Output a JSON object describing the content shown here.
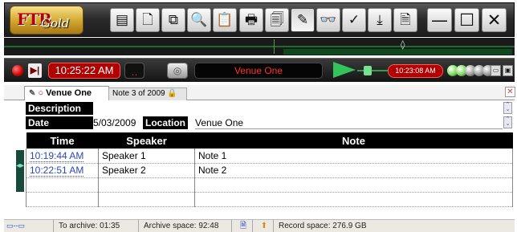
{
  "app": {
    "logo_main": "FTR",
    "logo_sub": "Gold"
  },
  "toolbar": {
    "buttons": [
      {
        "icon": "list-icon",
        "glyph": "▤"
      },
      {
        "icon": "new-page-icon",
        "glyph": "🗋"
      },
      {
        "icon": "copy-pages-icon",
        "glyph": "⧉"
      },
      {
        "icon": "find-page-icon",
        "glyph": "🔍"
      },
      {
        "icon": "paste-icon",
        "glyph": "📋"
      },
      {
        "icon": "print-icon",
        "glyph": "🖶"
      },
      {
        "icon": "print-preview-icon",
        "glyph": "🗐"
      },
      {
        "icon": "edit-note-icon",
        "glyph": "✎"
      },
      {
        "icon": "binoculars-icon",
        "glyph": "👓"
      },
      {
        "icon": "spellcheck-icon",
        "glyph": "✓"
      },
      {
        "icon": "insert-icon",
        "glyph": "⤓"
      },
      {
        "icon": "document-icon",
        "glyph": "🗎"
      }
    ],
    "window_controls": {
      "minimize": "—",
      "maximize": "☐",
      "close": "✕"
    }
  },
  "transport": {
    "current_time": "10:25:22 AM",
    "dots": "‥",
    "venue": "Venue One",
    "playback_time": "10:23:08 AM",
    "channel_colors": [
      "#7bdc5a",
      "#7bdc5a",
      "#9a9a9a",
      "#9a9a9a",
      "#9a9a9a"
    ]
  },
  "tabs": {
    "active_label": "Venue One",
    "inactive_label": "Note 3 of 2009"
  },
  "fields": {
    "description_label": "Description",
    "description_value": "",
    "date_label": "Date",
    "date_value": "5/03/2009",
    "location_label": "Location",
    "location_value": "Venue One"
  },
  "notes": {
    "columns": [
      "Time",
      "Speaker",
      "Note"
    ],
    "rows": [
      {
        "time": "10:19:44 AM",
        "speaker": "Speaker 1",
        "note": "Note 1"
      },
      {
        "time": "10:22:51 AM",
        "speaker": "Speaker 2",
        "note": "Note 2"
      },
      {
        "time": "",
        "speaker": "",
        "note": ""
      },
      {
        "time": "",
        "speaker": "",
        "note": ""
      }
    ]
  },
  "status": {
    "to_archive": "To archive: 01:35",
    "archive_space": "Archive space: 92:48",
    "record_space": "Record space: 276.9 GB"
  }
}
